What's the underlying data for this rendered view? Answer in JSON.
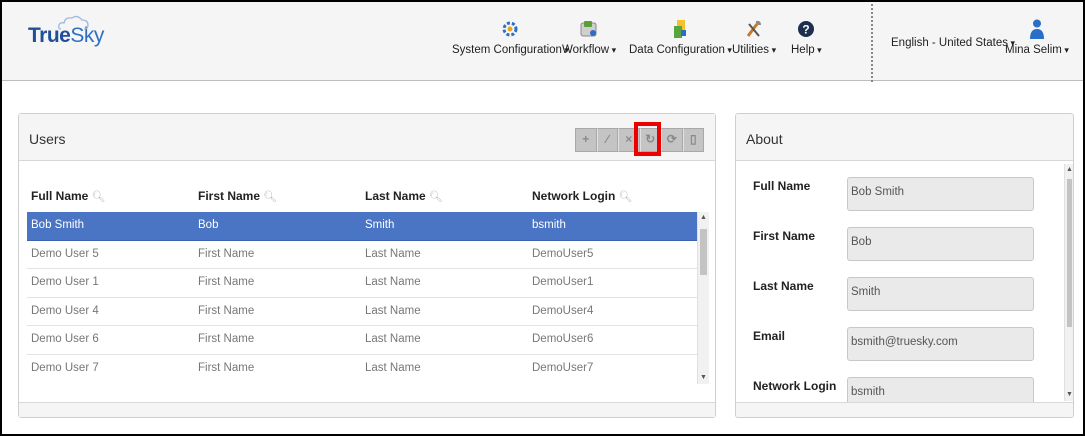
{
  "header": {
    "logo_true": "True",
    "logo_sky": "Sky",
    "nav": [
      {
        "label": "System Configuration",
        "icon": "gear-icon"
      },
      {
        "label": "Workflow",
        "icon": "workflow-icon"
      },
      {
        "label": "Data Configuration",
        "icon": "data-config-icon"
      },
      {
        "label": "Utilities",
        "icon": "utilities-icon"
      },
      {
        "label": "Help",
        "icon": "help-icon"
      }
    ],
    "language": "English - United States",
    "user_name": "Mina Selim"
  },
  "users_panel": {
    "title": "Users",
    "toolbar": {
      "add": "+",
      "edit": "∕",
      "delete": "×",
      "refresh": "↻",
      "redo": "⟳",
      "export": "▯"
    },
    "columns": [
      "Full Name",
      "First Name",
      "Last Name",
      "Network Login"
    ],
    "rows": [
      {
        "full_name": "Bob Smith",
        "first_name": "Bob",
        "last_name": "Smith",
        "network_login": "bsmith",
        "selected": true
      },
      {
        "full_name": "Demo User 5",
        "first_name": "First Name",
        "last_name": "Last Name",
        "network_login": "DemoUser5"
      },
      {
        "full_name": "Demo User 1",
        "first_name": "First Name",
        "last_name": "Last Name",
        "network_login": "DemoUser1"
      },
      {
        "full_name": "Demo User 4",
        "first_name": "First Name",
        "last_name": "Last Name",
        "network_login": "DemoUser4"
      },
      {
        "full_name": "Demo User 6",
        "first_name": "First Name",
        "last_name": "Last Name",
        "network_login": "DemoUser6"
      },
      {
        "full_name": "Demo User 7",
        "first_name": "First Name",
        "last_name": "Last Name",
        "network_login": "DemoUser7"
      }
    ]
  },
  "about_panel": {
    "title": "About",
    "fields": [
      {
        "label": "Full Name",
        "value": "Bob Smith"
      },
      {
        "label": "First Name",
        "value": "Bob"
      },
      {
        "label": "Last Name",
        "value": "Smith"
      },
      {
        "label": "Email",
        "value": "bsmith@truesky.com"
      },
      {
        "label": "Network Login",
        "value": "bsmith"
      }
    ]
  },
  "colors": {
    "selected_row": "#4a74c4",
    "highlight_box": "#ee0000",
    "logo_blue": "#1f4e9b"
  }
}
